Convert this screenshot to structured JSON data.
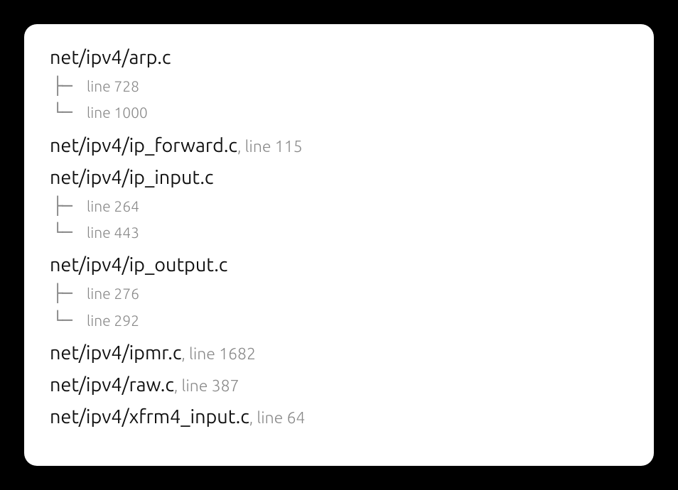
{
  "linePrefix": "line ",
  "files": [
    {
      "path": "net/ipv4/arp.c",
      "lines": [
        728,
        1000
      ]
    },
    {
      "path": "net/ipv4/ip_forward.c",
      "lines": [
        115
      ]
    },
    {
      "path": "net/ipv4/ip_input.c",
      "lines": [
        264,
        443
      ]
    },
    {
      "path": "net/ipv4/ip_output.c",
      "lines": [
        276,
        292
      ]
    },
    {
      "path": "net/ipv4/ipmr.c",
      "lines": [
        1682
      ]
    },
    {
      "path": "net/ipv4/raw.c",
      "lines": [
        387
      ]
    },
    {
      "path": "net/ipv4/xfrm4_input.c",
      "lines": [
        64
      ]
    }
  ]
}
